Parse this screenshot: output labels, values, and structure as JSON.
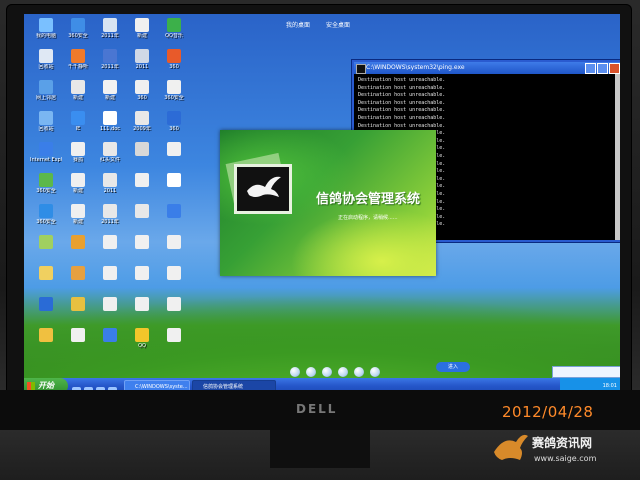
{
  "top_strip": [
    "我的桌面",
    "安全桌面"
  ],
  "desktop_icons": [
    {
      "label": "我的电脑",
      "color": "#7ac0ff"
    },
    {
      "label": "360安全",
      "color": "#3f8de6"
    },
    {
      "label": "2011年",
      "color": "#d8e4f2"
    },
    {
      "label": "新建",
      "color": "#f0f0f0"
    },
    {
      "label": "QQ音乐",
      "color": "#3cb04a"
    },
    {
      "label": "回收站",
      "color": "#dfe8f4"
    },
    {
      "label": "千千静听",
      "color": "#f07a2a"
    },
    {
      "label": "2011年",
      "color": "#4a76d2"
    },
    {
      "label": "2011",
      "color": "#d0d8e6"
    },
    {
      "label": "360",
      "color": "#e85a2a"
    },
    {
      "label": "网上邻居",
      "color": "#5aa0e8"
    },
    {
      "label": "新建",
      "color": "#e8e8e8"
    },
    {
      "label": "新建",
      "color": "#f2f2f2"
    },
    {
      "label": "360",
      "color": "#f0f0f0"
    },
    {
      "label": "360安全",
      "color": "#f0f0f0"
    },
    {
      "label": "回收站",
      "color": "#7ab6f2"
    },
    {
      "label": "IE",
      "color": "#3a8ef0"
    },
    {
      "label": "111.doc",
      "color": "#ffffff"
    },
    {
      "label": "2009年",
      "color": "#e8e8e8"
    },
    {
      "label": "360",
      "color": "#2c6bd6"
    },
    {
      "label": "Internet Explorer",
      "color": "#3a7ee8"
    },
    {
      "label": "赛鸽",
      "color": "#f0f0f0"
    },
    {
      "label": "红头文件",
      "color": "#e8e8e8"
    },
    {
      "label": "",
      "color": "#d8d8d8"
    },
    {
      "label": "",
      "color": "#f0f0f0"
    },
    {
      "label": "360安全",
      "color": "#5cb84a"
    },
    {
      "label": "新建",
      "color": "#f0f0f0"
    },
    {
      "label": "2011",
      "color": "#e8e8e8"
    },
    {
      "label": "",
      "color": "#f0f0f0"
    },
    {
      "label": "",
      "color": "#ffffff"
    },
    {
      "label": "360安全",
      "color": "#2f8de6"
    },
    {
      "label": "新建",
      "color": "#f0f0f0"
    },
    {
      "label": "2011年",
      "color": "#e8e8e8"
    },
    {
      "label": "",
      "color": "#e8e8e8"
    },
    {
      "label": "",
      "color": "#3a7ee8"
    },
    {
      "label": "",
      "color": "#a0d060"
    },
    {
      "label": "",
      "color": "#e8a030"
    },
    {
      "label": "",
      "color": "#f0f0f0"
    },
    {
      "label": "",
      "color": "#f0f0f0"
    },
    {
      "label": "",
      "color": "#f0f0f0"
    },
    {
      "label": "",
      "color": "#f0d060"
    },
    {
      "label": "",
      "color": "#e6a040"
    },
    {
      "label": "",
      "color": "#f0f0f0"
    },
    {
      "label": "",
      "color": "#f0f0f0"
    },
    {
      "label": "",
      "color": "#f0f0f0"
    },
    {
      "label": "",
      "color": "#2a6bd6"
    },
    {
      "label": "",
      "color": "#e8c040"
    },
    {
      "label": "",
      "color": "#f0f0f0"
    },
    {
      "label": "",
      "color": "#f0f0f0"
    },
    {
      "label": "",
      "color": "#f0f0f0"
    },
    {
      "label": "",
      "color": "#f0c040"
    },
    {
      "label": "",
      "color": "#f0f0f0"
    },
    {
      "label": "",
      "color": "#3a7ee8"
    },
    {
      "label": "QQ",
      "color": "#f2c62a"
    },
    {
      "label": "",
      "color": "#f0f0f0"
    }
  ],
  "cmd": {
    "title": "C:\\WINDOWS\\system32\\ping.exe",
    "lines": [
      "Destination host unreachable.",
      "Destination host unreachable.",
      "Destination host unreachable.",
      "Destination host unreachable.",
      "Destination host unreachable.",
      "Destination host unreachable.",
      "Destination host unreachable.",
      "Destination host unreachable.",
      "Destination host unreachable.",
      "Destination host unreachable.",
      "Destination host unreachable.",
      "Destination host unreachable.",
      "Destination host unreachable.",
      "Destination host unreachable.",
      "Destination host unreachable.",
      "Destination host unreachable.",
      "Destination host unreachable.",
      "Destination host unreachable.",
      "Destination host unreachable.",
      "Destination host unreachable."
    ]
  },
  "splash": {
    "title": "信鸽协会管理系统",
    "loading": "正在启动程序，请稍候......"
  },
  "taskbar": {
    "start": "开始",
    "tasks": [
      "C:\\WINDOWS\\syste...",
      "信鸽协会管理系统"
    ],
    "clock": "18:01"
  },
  "dock_button": "进入",
  "photo_date": "2012/04/28",
  "watermark": {
    "brand": "赛鸽资讯网",
    "url": "www.saige.com"
  }
}
